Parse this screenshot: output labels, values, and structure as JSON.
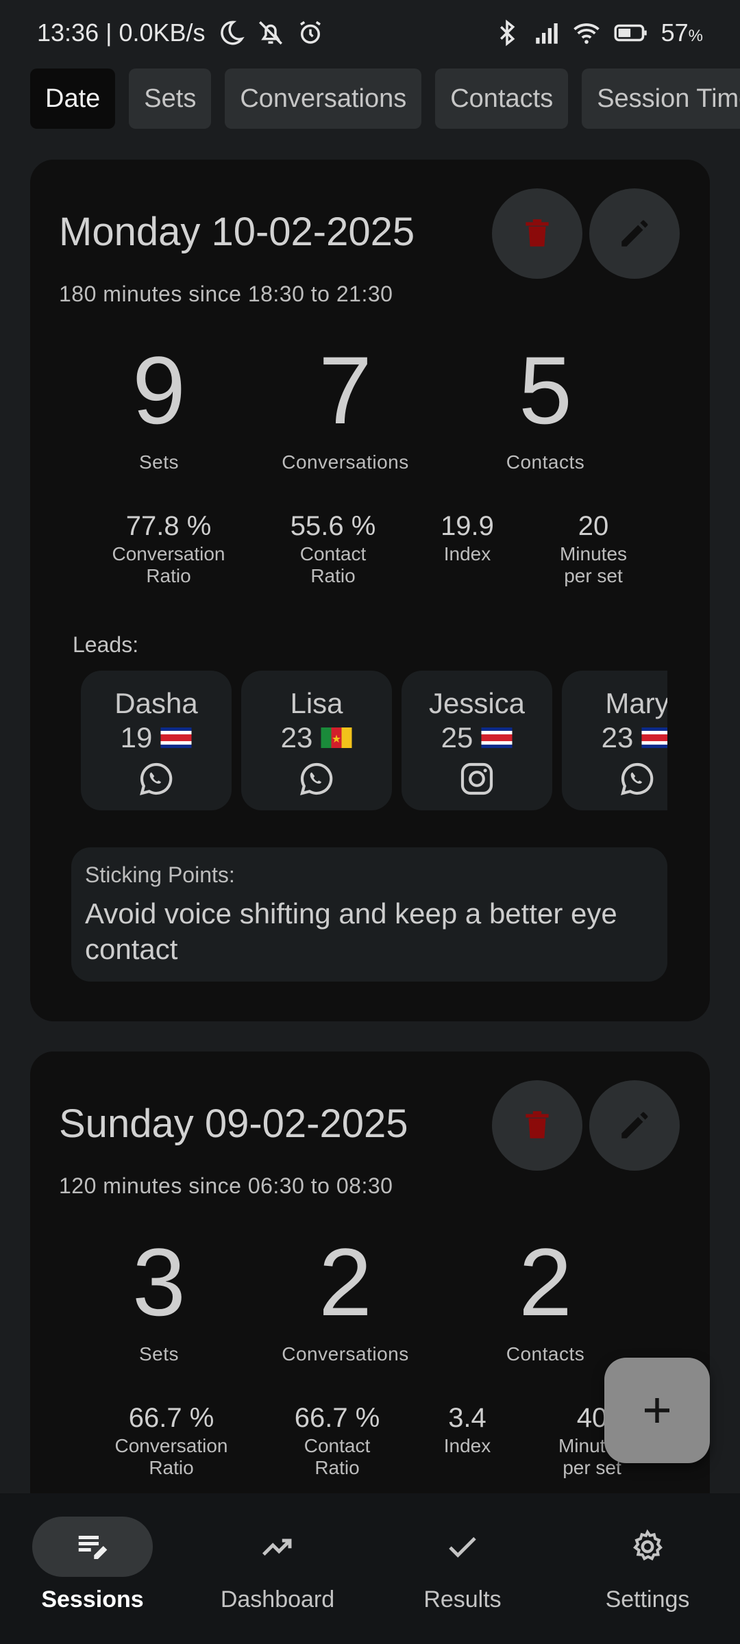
{
  "status_bar": {
    "time_speed": "13:36 | 0.0KB/s",
    "battery_pct": "57",
    "battery_unit": "%",
    "icons": [
      "moon-icon",
      "mute-icon",
      "alarm-icon",
      "bluetooth-icon",
      "signal-icon",
      "wifi-icon",
      "battery-icon"
    ]
  },
  "filters": [
    {
      "label": "Date",
      "active": true
    },
    {
      "label": "Sets",
      "active": false
    },
    {
      "label": "Conversations",
      "active": false
    },
    {
      "label": "Contacts",
      "active": false
    },
    {
      "label": "Session Time",
      "active": false
    }
  ],
  "sessions": [
    {
      "title": "Monday 10-02-2025",
      "subtitle": "180 minutes since 18:30 to 21:30",
      "big_stats": [
        {
          "value": "9",
          "label": "Sets"
        },
        {
          "value": "7",
          "label": "Conversations"
        },
        {
          "value": "5",
          "label": "Contacts"
        }
      ],
      "small_stats": [
        {
          "value": "77.8 %",
          "label_1": "Conversation",
          "label_2": "Ratio"
        },
        {
          "value": "55.6 %",
          "label_1": "Contact",
          "label_2": "Ratio"
        },
        {
          "value": "19.9",
          "label_1": "Index",
          "label_2": ""
        },
        {
          "value": "20",
          "label_1": "Minutes",
          "label_2": "per set"
        }
      ],
      "leads_label": "Leads:",
      "leads": [
        {
          "name": "Dasha",
          "age": "19",
          "flag": "costa-rica",
          "social": "whatsapp-icon"
        },
        {
          "name": "Lisa",
          "age": "23",
          "flag": "cameroon",
          "social": "whatsapp-icon"
        },
        {
          "name": "Jessica",
          "age": "25",
          "flag": "costa-rica",
          "social": "instagram-icon"
        },
        {
          "name": "Mary",
          "age": "23",
          "flag": "costa-rica",
          "social": "whatsapp-icon"
        }
      ],
      "sticking_label": "Sticking Points:",
      "sticking_text": "Avoid voice shifting and keep a better eye contact"
    },
    {
      "title": "Sunday 09-02-2025",
      "subtitle": "120 minutes since 06:30 to 08:30",
      "big_stats": [
        {
          "value": "3",
          "label": "Sets"
        },
        {
          "value": "2",
          "label": "Conversations"
        },
        {
          "value": "2",
          "label": "Contacts"
        }
      ],
      "small_stats": [
        {
          "value": "66.7 %",
          "label_1": "Conversation",
          "label_2": "Ratio"
        },
        {
          "value": "66.7 %",
          "label_1": "Contact",
          "label_2": "Ratio"
        },
        {
          "value": "3.4",
          "label_1": "Index",
          "label_2": ""
        },
        {
          "value": "40",
          "label_1": "Minutes",
          "label_2": "per set"
        }
      ]
    }
  ],
  "fab_icon": "plus-icon",
  "nav": [
    {
      "label": "Sessions",
      "icon": "sessions-edit-icon",
      "active": true
    },
    {
      "label": "Dashboard",
      "icon": "trending-up-icon",
      "active": false
    },
    {
      "label": "Results",
      "icon": "check-icon",
      "active": false
    },
    {
      "label": "Settings",
      "icon": "gear-icon",
      "active": false
    }
  ],
  "colors": {
    "background": "#1b1d1f",
    "card": "#0f0f0f",
    "delete_red": "#8b0a0a",
    "active_chip": "#0b0b0b",
    "fab": "#8a8a8a"
  }
}
